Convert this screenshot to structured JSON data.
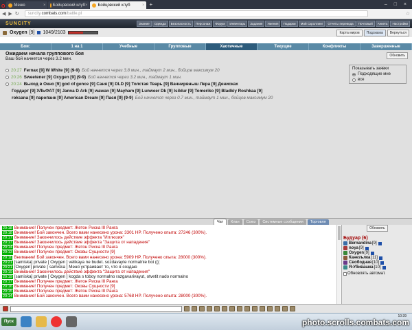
{
  "browser": {
    "tabs": [
      {
        "label": "Меню",
        "active": false
      },
      {
        "label": "Бойцовский клуб",
        "active": false
      },
      {
        "label": "Бойцовский клуб",
        "active": true
      }
    ],
    "url_prefix": "suncity.",
    "url_domain": "combats.com",
    "url_path": "/battle.pl"
  },
  "header": {
    "brand": "SUNCITY",
    "menu": [
      "Знание",
      "Одежда",
      "Безопасность",
      "Персонаж",
      "Форум",
      "Инвентарь",
      "Задания",
      "Умения",
      "Подарки",
      "Мой Скроллинг",
      "Отчеты перевода",
      "Почтовый",
      "Анкета",
      "Настройки"
    ]
  },
  "character": {
    "name": "Oxygen",
    "level": "[9]",
    "hp": "1049/2103",
    "hp_fraction": 0.5,
    "buttons": [
      "Карта миров",
      "Подсказка",
      "Вернуться"
    ]
  },
  "fight_tabs": [
    "Бои:",
    "1 на 1",
    "Учебные",
    "Групповые",
    "Хаотичные",
    "Текущие",
    "Конфликты",
    "Завершенные"
  ],
  "active_tab": "Хаотичные",
  "battle": {
    "title": "Ожидаем начала группового боя",
    "subtitle": "Ваш бой начнется через 3.2 мин.",
    "update_button": "Обновить",
    "requests": [
      {
        "time": "20:27",
        "players": "Fernax [9] W White [9] (9-9)",
        "info": "Бой начнется через 3.8 мин., таймаут 2 мин., бойцов максимум 20"
      },
      {
        "time": "20:26",
        "players": "Sweetener [9] Oxygen [9] (9-9)",
        "info": "Бой начнется через 3.2 мин., таймаут 1 мин."
      },
      {
        "time": "20:24",
        "players": "Выход в Окно [9] god of gence [9] Саня [9] DLD [9] Толстая Тварь [9] Вачнирвныш Лера [9] Денискаx"
      },
      {
        "time": "",
        "players": "Гордарт [9] УЛЬФАТ [9] Janna D Ark [9] wawan [9] Mayham [9] Lunweer Dk [9] Isildur [9] Tomeriko [9] Bladkiy Roshkaa [9]"
      },
      {
        "time": "",
        "players": "roksana [9] паропанк [9] American Dream [9] Пася [9] (9-9)",
        "info": "Бой начнется через 0.7 мин., таймаут 1 мин., бойцов максимум 20"
      }
    ],
    "filter_title": "Показывать заявки",
    "filter_options": [
      "Подходящие мне",
      "все"
    ]
  },
  "chat": {
    "tabs": [
      "Чат",
      "Клан",
      "Союз",
      "Системные сообщения",
      "Торговля"
    ],
    "lines": [
      {
        "time": "20:18",
        "text": "Внимание! Получен предмет: Жетон Риска III Ранга"
      },
      {
        "time": "20:18",
        "text": "Внимание! Бой закончен. Всего вами нанесено урона: 3301 HP. Получено опыта: 27246 (300%)."
      },
      {
        "time": "20:17",
        "text": "Внимание! Закончилось действие эффекта \"Иллюзия\""
      },
      {
        "time": "20:17",
        "text": "Внимание! Закончилось действие эффекта \"Защита от нападения\""
      },
      {
        "time": "20:14",
        "text": "Внимание! Получен предмет: Жетон Риска III Ранга"
      },
      {
        "time": "20:13",
        "text": "Внимание! Получен предмет: Оковы Сущности [9]"
      },
      {
        "time": "20:11",
        "text": "Внимание! Бой закончен. Всего вами нанесено урона: 5909 HP. Получено опыта: 28000 (300%)."
      },
      {
        "time": "20:21",
        "text": "[samiska] private [ Oxygen ] velikaya ne budet. sozdavayte normalnie boi ((("
      },
      {
        "time": "20:21",
        "text": "[Oxygen] private [ samiska ] Меня устраивает то, что я создаю"
      },
      {
        "time": "20:19",
        "text": "Внимание! Закончилось действие эффекта \"Защита от нападения\""
      },
      {
        "time": "20:19",
        "text": "[samiska] private [ Oxygen ] kogda s toboy normalno razgavarivayut, otvetit nado normalno"
      },
      {
        "time": "20:17",
        "text": "Внимание! Получен предмет: Жетон Риска III Ранга"
      },
      {
        "time": "20:16",
        "text": "Внимание! Получен предмет: Оковы Сущности [9]"
      },
      {
        "time": "20:15",
        "text": "Внимание! Получен предмет: Жетон Риска III Ранга"
      },
      {
        "time": "20:14",
        "text": "Внимание! Бой закончен. Всего вами нанесено урона: 5768 HP. Получено опыта: 28000 (300%)."
      }
    ]
  },
  "boudoir": {
    "update": "Обновить",
    "title": "Будуар (6)",
    "players": [
      {
        "name": "Bernandina",
        "level": "[9]"
      },
      {
        "name": "noya",
        "level": "[9]"
      },
      {
        "name": "Oxygen",
        "level": "[9]"
      },
      {
        "name": "Канезълка",
        "level": "[11]"
      },
      {
        "name": "Свободная",
        "level": "[10]"
      },
      {
        "name": "Я-Убивашка",
        "level": "[10]"
      }
    ],
    "auto_label": "Обновлять автомат."
  },
  "taskbar": {
    "start": "Пуск",
    "clock": "10:39"
  },
  "watermark": "photo.scrolls.combats.com"
}
